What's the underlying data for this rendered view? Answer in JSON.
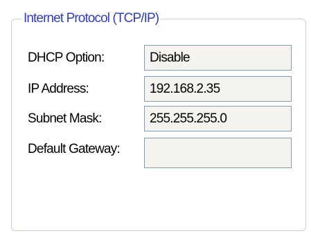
{
  "group": {
    "title": "Internet Protocol (TCP/IP)"
  },
  "fields": [
    {
      "label": "DHCP Option:",
      "value": "Disable"
    },
    {
      "label": "IP Address:",
      "value": "192.168.2.35"
    },
    {
      "label": "Subnet Mask:",
      "value": "255.255.255.0"
    },
    {
      "label": "Default Gateway:",
      "value": ""
    }
  ],
  "colors": {
    "group_title": "#2f3cc8",
    "group_border": "#d0d0bf",
    "field_border": "#7f9db9",
    "field_background": "#f4f3ee"
  }
}
